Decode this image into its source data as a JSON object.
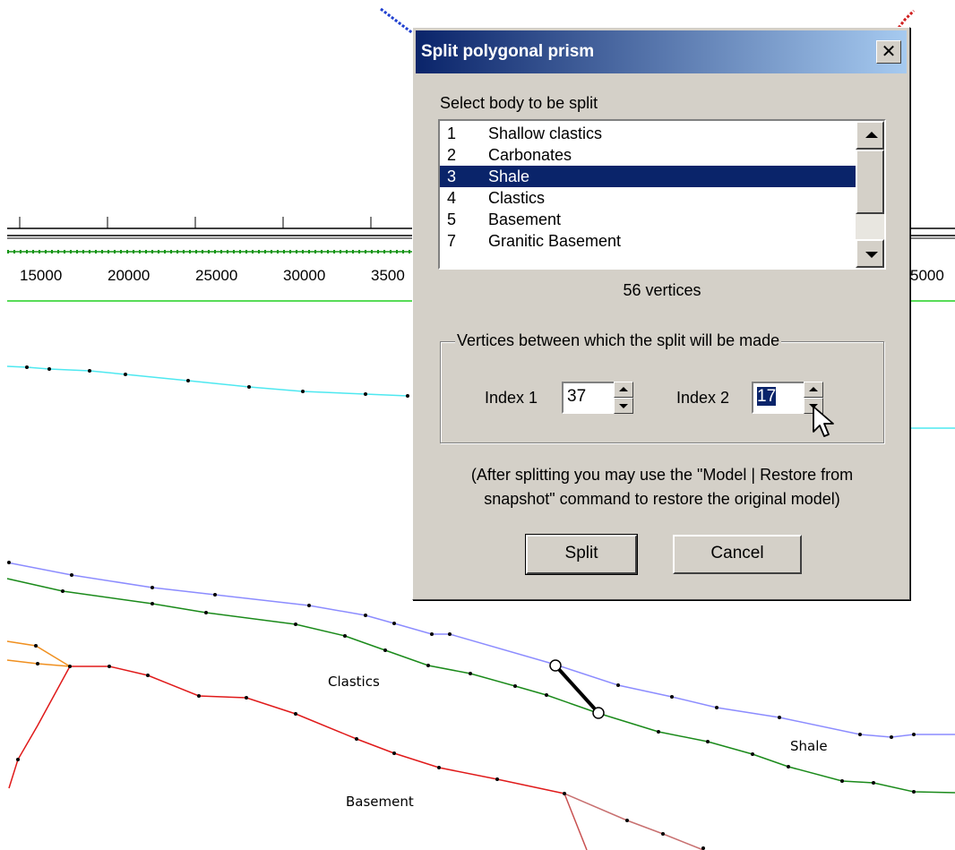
{
  "axis": {
    "ticks": [
      "15000",
      "20000",
      "25000",
      "30000",
      "3500",
      "5000"
    ]
  },
  "body_labels": {
    "clastics": "Clastics",
    "shale": "Shale",
    "basement": "Basement"
  },
  "colors": {
    "cyan_boundary": "#4ee8f0",
    "blue_boundary": "#8c8cff",
    "green_boundary": "#1a8a1a",
    "red_boundary": "#e01a1a",
    "orange_boundary": "#f09020",
    "split_line": "#000000",
    "title_gradient_start": "#0a246a",
    "title_gradient_end": "#a6caf0"
  },
  "dialog": {
    "title": "Split polygonal prism",
    "close_label": "✕",
    "prompt": "Select body to be split",
    "bodies": [
      {
        "num": "1",
        "name": "Shallow clastics"
      },
      {
        "num": "2",
        "name": "Carbonates"
      },
      {
        "num": "3",
        "name": "Shale"
      },
      {
        "num": "4",
        "name": "Clastics"
      },
      {
        "num": "5",
        "name": "Basement"
      },
      {
        "num": "7",
        "name": "Granitic Basement"
      }
    ],
    "selected_body": "3",
    "vertex_count": "56  vertices",
    "group_title": "Vertices between which the split will be made",
    "index1_label": "Index 1",
    "index1_value": "37",
    "index2_label": "Index 2",
    "index2_value": "17",
    "note_line1": "(After splitting you may use the \"Model | Restore from",
    "note_line2": "snapshot\" command to restore the original model)",
    "split_label": "Split",
    "cancel_label": "Cancel"
  }
}
